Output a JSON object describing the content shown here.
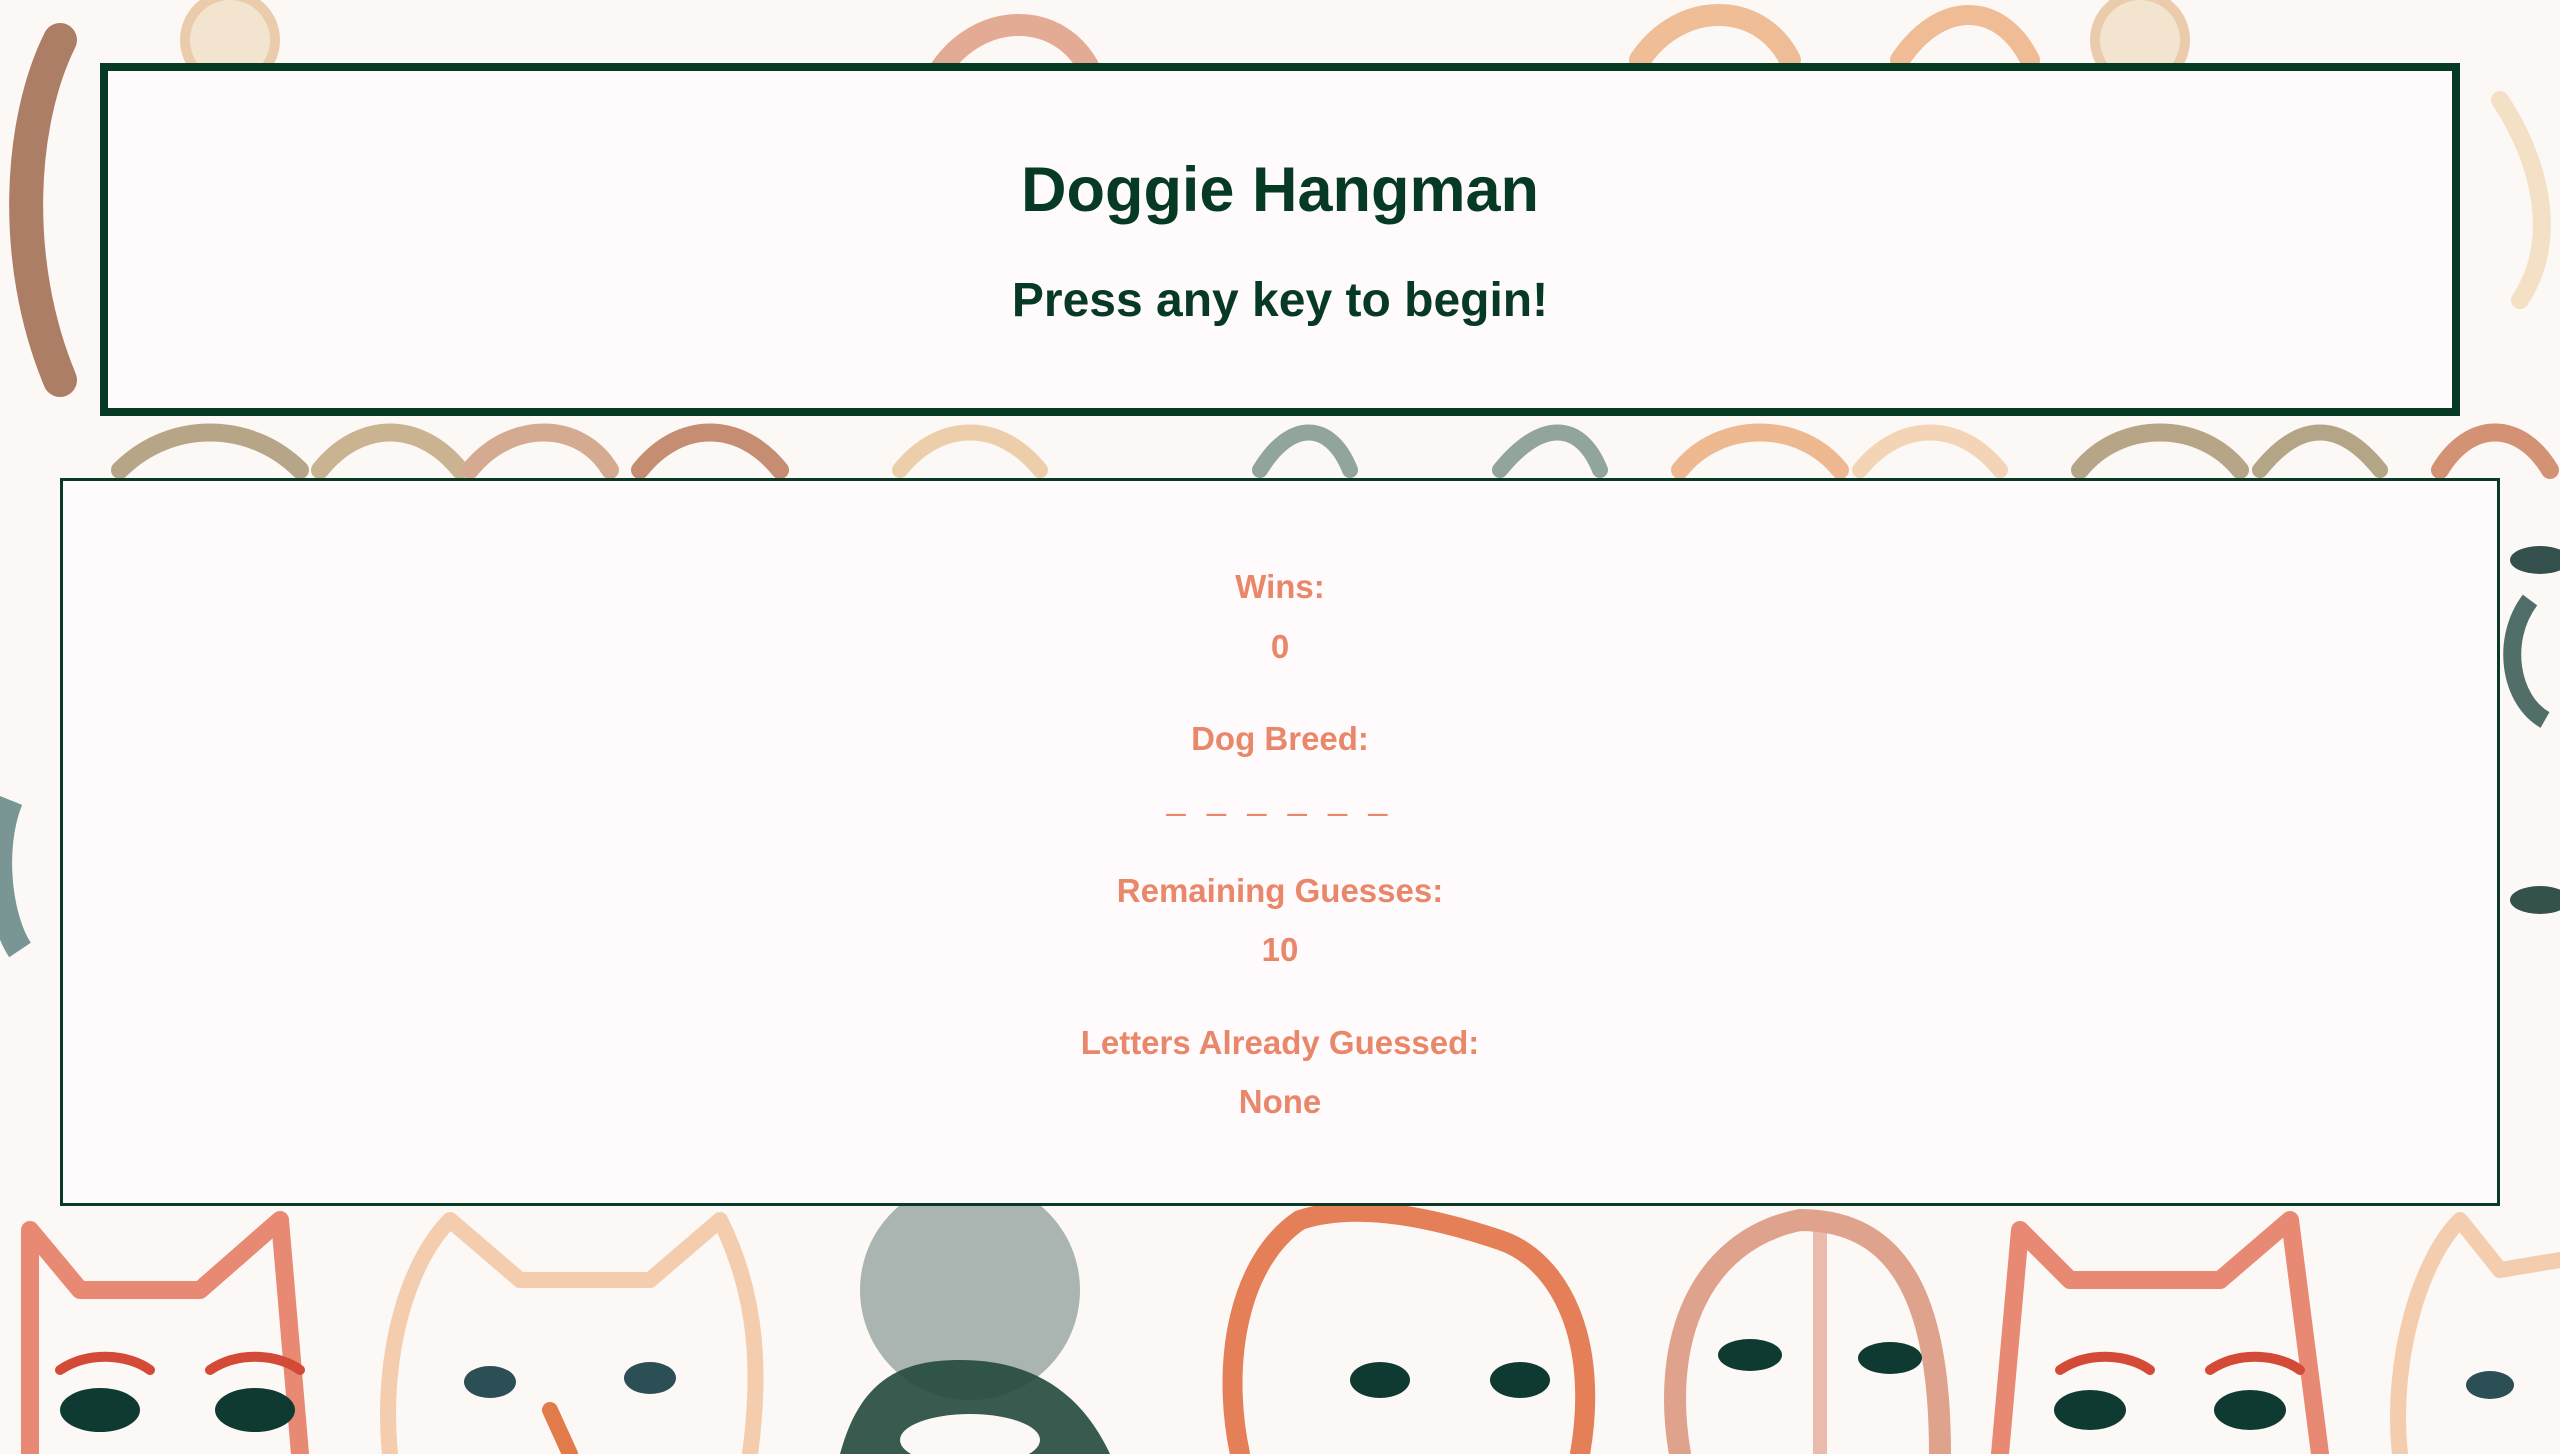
{
  "header": {
    "title": "Doggie Hangman",
    "prompt": "Press any key to begin!"
  },
  "stats": {
    "wins_label": "Wins:",
    "wins_value": "0",
    "breed_label": "Dog Breed:",
    "breed_value": "_ _ _ _ _ _",
    "remaining_label": "Remaining Guesses:",
    "remaining_value": "10",
    "guessed_label": "Letters Already Guessed:",
    "guessed_value": "None"
  },
  "colors": {
    "title_green": "#073a24",
    "stat_salmon": "#e8876a",
    "panel_bg": "#fffafb"
  },
  "background": {
    "description_icon": "watercolor-dog-faces-pattern"
  }
}
